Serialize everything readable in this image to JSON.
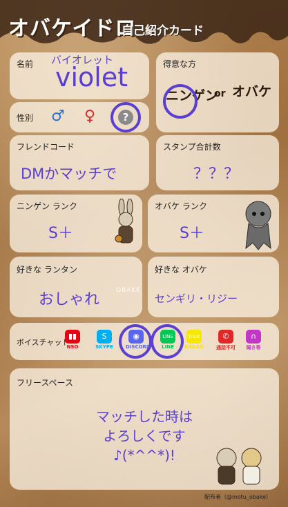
{
  "header": {
    "logo": "オバケイドロ",
    "title": "自己紹介カード"
  },
  "name": {
    "label": "名前",
    "reading": "バイオレット",
    "value": "violet"
  },
  "gender": {
    "label": "性別",
    "male": "♂",
    "female": "♀",
    "unknown": "?"
  },
  "skill": {
    "label": "得意な方",
    "left": "ニンゲン",
    "or": "or",
    "right": "オバケ"
  },
  "friend_code": {
    "label": "フレンドコード",
    "value": "DMかマッチで"
  },
  "stamp_total": {
    "label": "スタンプ合計数",
    "value": "？？？"
  },
  "human_rank": {
    "label": "ニンゲン ランク",
    "value": "S＋"
  },
  "ghost_rank": {
    "label": "オバケ ランク",
    "value": "S＋"
  },
  "fav_lantern": {
    "label": "好きな ランタン",
    "value": "おしゃれ"
  },
  "fav_ghost": {
    "label": "好きな オバケ",
    "value": "センギリ・リジー"
  },
  "voice_chat": {
    "label": "ボイスチャット",
    "items": [
      {
        "name": "NSO",
        "glyph": "▮▮",
        "color": "#e60012"
      },
      {
        "name": "SKYPE",
        "glyph": "S",
        "color": "#00aff0"
      },
      {
        "name": "DISCORD",
        "glyph": "◉",
        "color": "#5865f2"
      },
      {
        "name": "LINE",
        "glyph": "LINE",
        "color": "#06c755"
      },
      {
        "name": "KAKAO",
        "glyph": "TALK",
        "color": "#f7e600"
      },
      {
        "name": "通話不可",
        "glyph": "✆",
        "color": "#e02828"
      },
      {
        "name": "聞き専",
        "glyph": "∩",
        "color": "#c236c8"
      }
    ]
  },
  "free_space": {
    "label": "フリースペース",
    "lines": [
      "マッチした時は",
      "よろしくです",
      "♪(*^^*)!"
    ]
  },
  "watermark": "OBAKE",
  "credit": "配布者（@motu_obake）",
  "colors": {
    "accent": "#5a3fd0",
    "male": "#2a6fd8",
    "female": "#e02828"
  }
}
